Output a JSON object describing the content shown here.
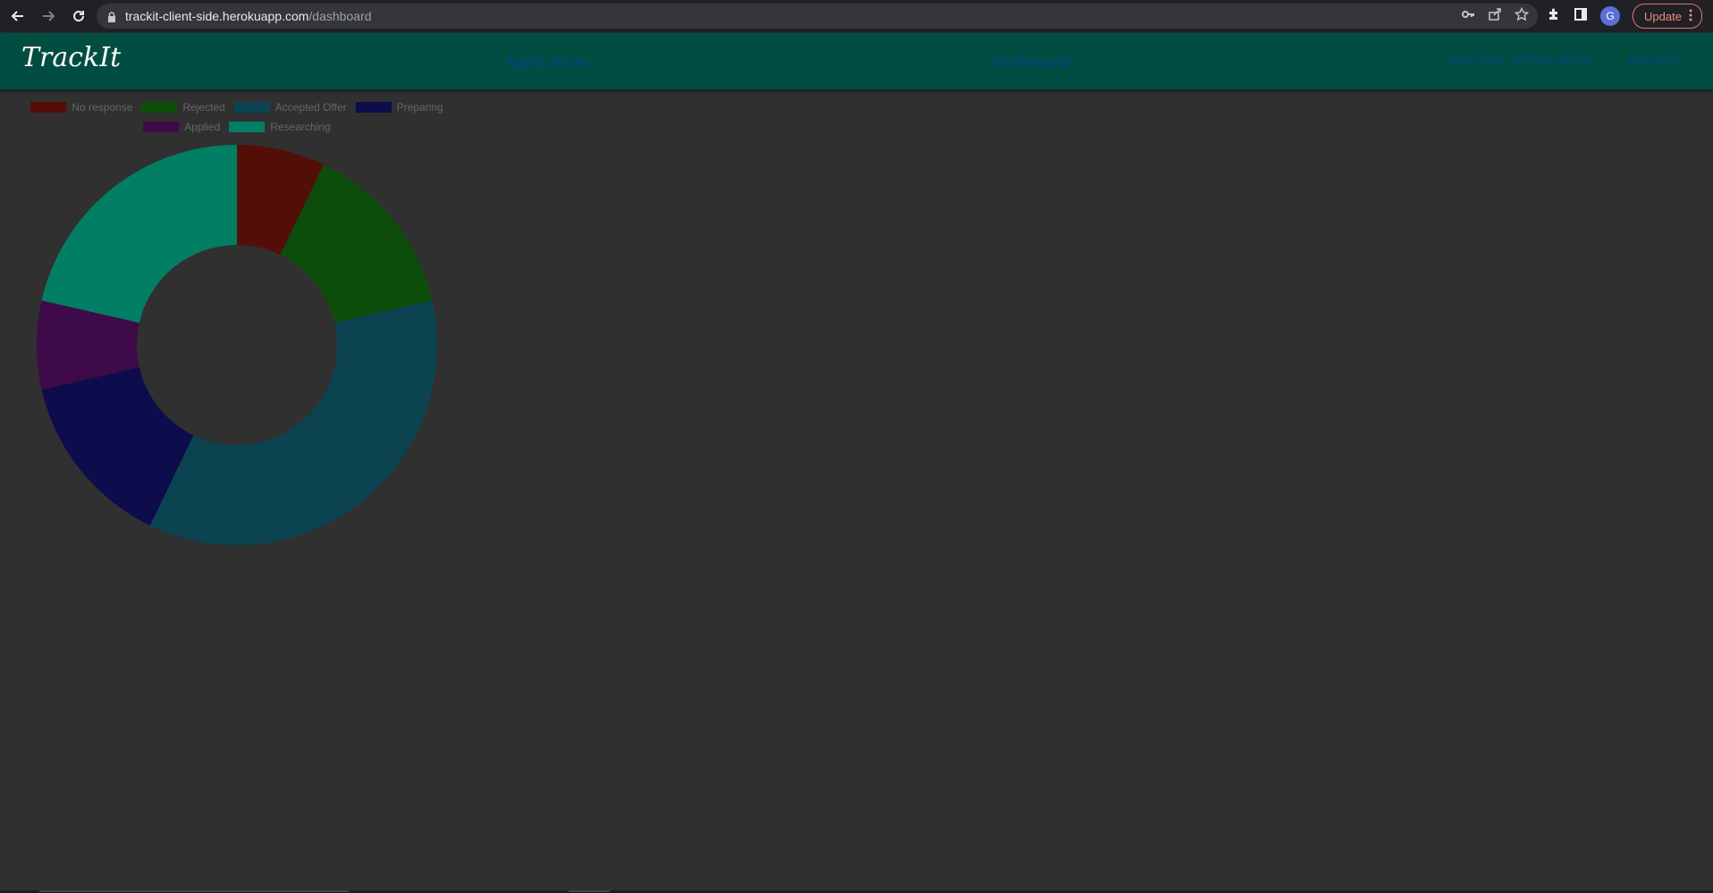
{
  "browser": {
    "url_host": "trackit-client-side.herokuapp.com",
    "url_path": "/dashboard",
    "avatar_letter": "G",
    "update_label": "Update",
    "icons": [
      "back-arrow-icon",
      "forward-arrow-icon",
      "reload-icon",
      "lock-icon",
      "key-icon",
      "share-icon",
      "star-icon",
      "extensions-icon",
      "side-panel-icon",
      "menu-dots-icon"
    ]
  },
  "header": {
    "brand": "TrackIt",
    "nav_applications": "Applications",
    "nav_dashboard": "Dashboard",
    "nav_add": "ADD NEW APPLICATION",
    "nav_logout": "LOGOUT",
    "background": "#014d41",
    "link_color": "#0a3f8a"
  },
  "chart_data": {
    "type": "doughnut",
    "legend_position": "top",
    "series": [
      {
        "name": "No response",
        "value": 1,
        "color": "#540e08"
      },
      {
        "name": "Rejected",
        "value": 2,
        "color": "#0d4d0b"
      },
      {
        "name": "Accepted Offer",
        "value": 5,
        "color": "#0b4350"
      },
      {
        "name": "Preparing",
        "value": 2,
        "color": "#0d0c4d"
      },
      {
        "name": "Applied",
        "value": 1,
        "color": "#3f0a49"
      },
      {
        "name": "Researching",
        "value": 3,
        "color": "#027e64"
      }
    ]
  }
}
